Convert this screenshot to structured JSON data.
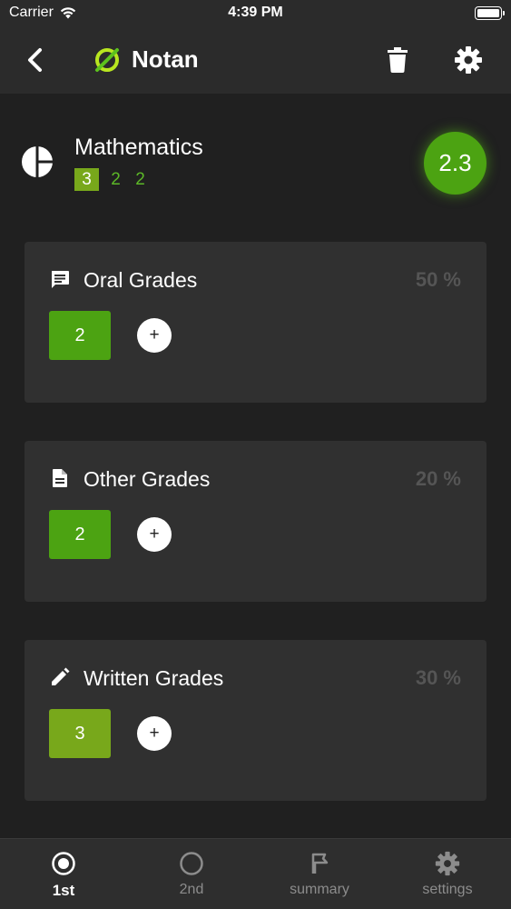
{
  "status_bar": {
    "carrier": "Carrier",
    "time": "4:39 PM",
    "battery_level": 1.0
  },
  "nav": {
    "title": "Notan",
    "back_icon": "chevron-left-icon",
    "logo_icon": "notan-logo-icon",
    "delete_icon": "trash-icon",
    "settings_icon": "gear-icon"
  },
  "subject": {
    "icon": "pie-chart-icon",
    "name": "Mathematics",
    "grades": [
      "3",
      "2",
      "2"
    ],
    "average": "2.3",
    "colors": {
      "average": "#4ca312",
      "grade_text": "#5cb827",
      "first_grade_bg": "#78a81b"
    }
  },
  "categories": [
    {
      "icon": "chat-icon",
      "title": "Oral Grades",
      "percent": "50 %",
      "grades": [
        "2"
      ],
      "grade_color": "#4ca312"
    },
    {
      "icon": "document-icon",
      "title": "Other Grades",
      "percent": "20 %",
      "grades": [
        "2"
      ],
      "grade_color": "#4ca312"
    },
    {
      "icon": "pencil-icon",
      "title": "Written Grades",
      "percent": "30 %",
      "grades": [
        "3"
      ],
      "grade_color": "#78a81b"
    }
  ],
  "add_label": "+",
  "tabs": [
    {
      "label": "1st",
      "icon": "radio-checked-icon",
      "active": true
    },
    {
      "label": "2nd",
      "icon": "radio-unchecked-icon",
      "active": false
    },
    {
      "label": "summary",
      "icon": "flag-icon",
      "active": false
    },
    {
      "label": "settings",
      "icon": "gear-icon",
      "active": false
    }
  ]
}
